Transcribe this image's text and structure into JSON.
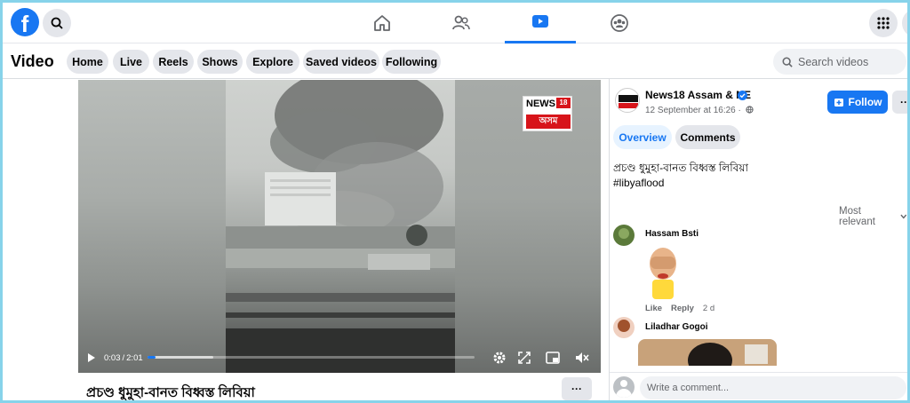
{
  "brand": {
    "color": "#1877f2"
  },
  "topnav": {
    "tabs": [
      {
        "icon": "home-icon",
        "active": false
      },
      {
        "icon": "friends-icon",
        "active": false
      },
      {
        "icon": "watch-icon",
        "active": true
      },
      {
        "icon": "groups-icon",
        "active": false
      }
    ]
  },
  "video_header": {
    "title": "Video",
    "nav": [
      "Home",
      "Live",
      "Reels",
      "Shows",
      "Explore",
      "Saved videos",
      "Following"
    ],
    "search_placeholder": "Search videos"
  },
  "player": {
    "current_time": "0:03",
    "separator": "/",
    "duration": "2:01",
    "progress_fraction": 0.025,
    "buffered_fraction": 0.2,
    "overlay_logo_top": "NEWS",
    "overlay_logo_sup": "18",
    "overlay_logo_bottom": "অসম"
  },
  "video_caption": "প্ৰচণ্ড ধুমুহা-বানত বিধ্বস্ত লিবিয়া",
  "more_label": "···",
  "post": {
    "page_name": "News18 Assam & NE",
    "date": "12 September at 16:26 ·",
    "follow_label": "Follow",
    "more_label": "···",
    "tabs": [
      "Overview",
      "Comments"
    ],
    "description_line1": "প্ৰচণ্ড ধুমুহা-বানত বিধ্বস্ত লিবিয়া",
    "description_line2": "#libyaflood",
    "sort_label": "Most relevant"
  },
  "comments": [
    {
      "name": "Hassam Bsti",
      "like": "Like",
      "reply": "Reply",
      "time": "2 d"
    },
    {
      "name": "Liladhar Gogoi"
    }
  ],
  "write_comment_placeholder": "Write a comment..."
}
